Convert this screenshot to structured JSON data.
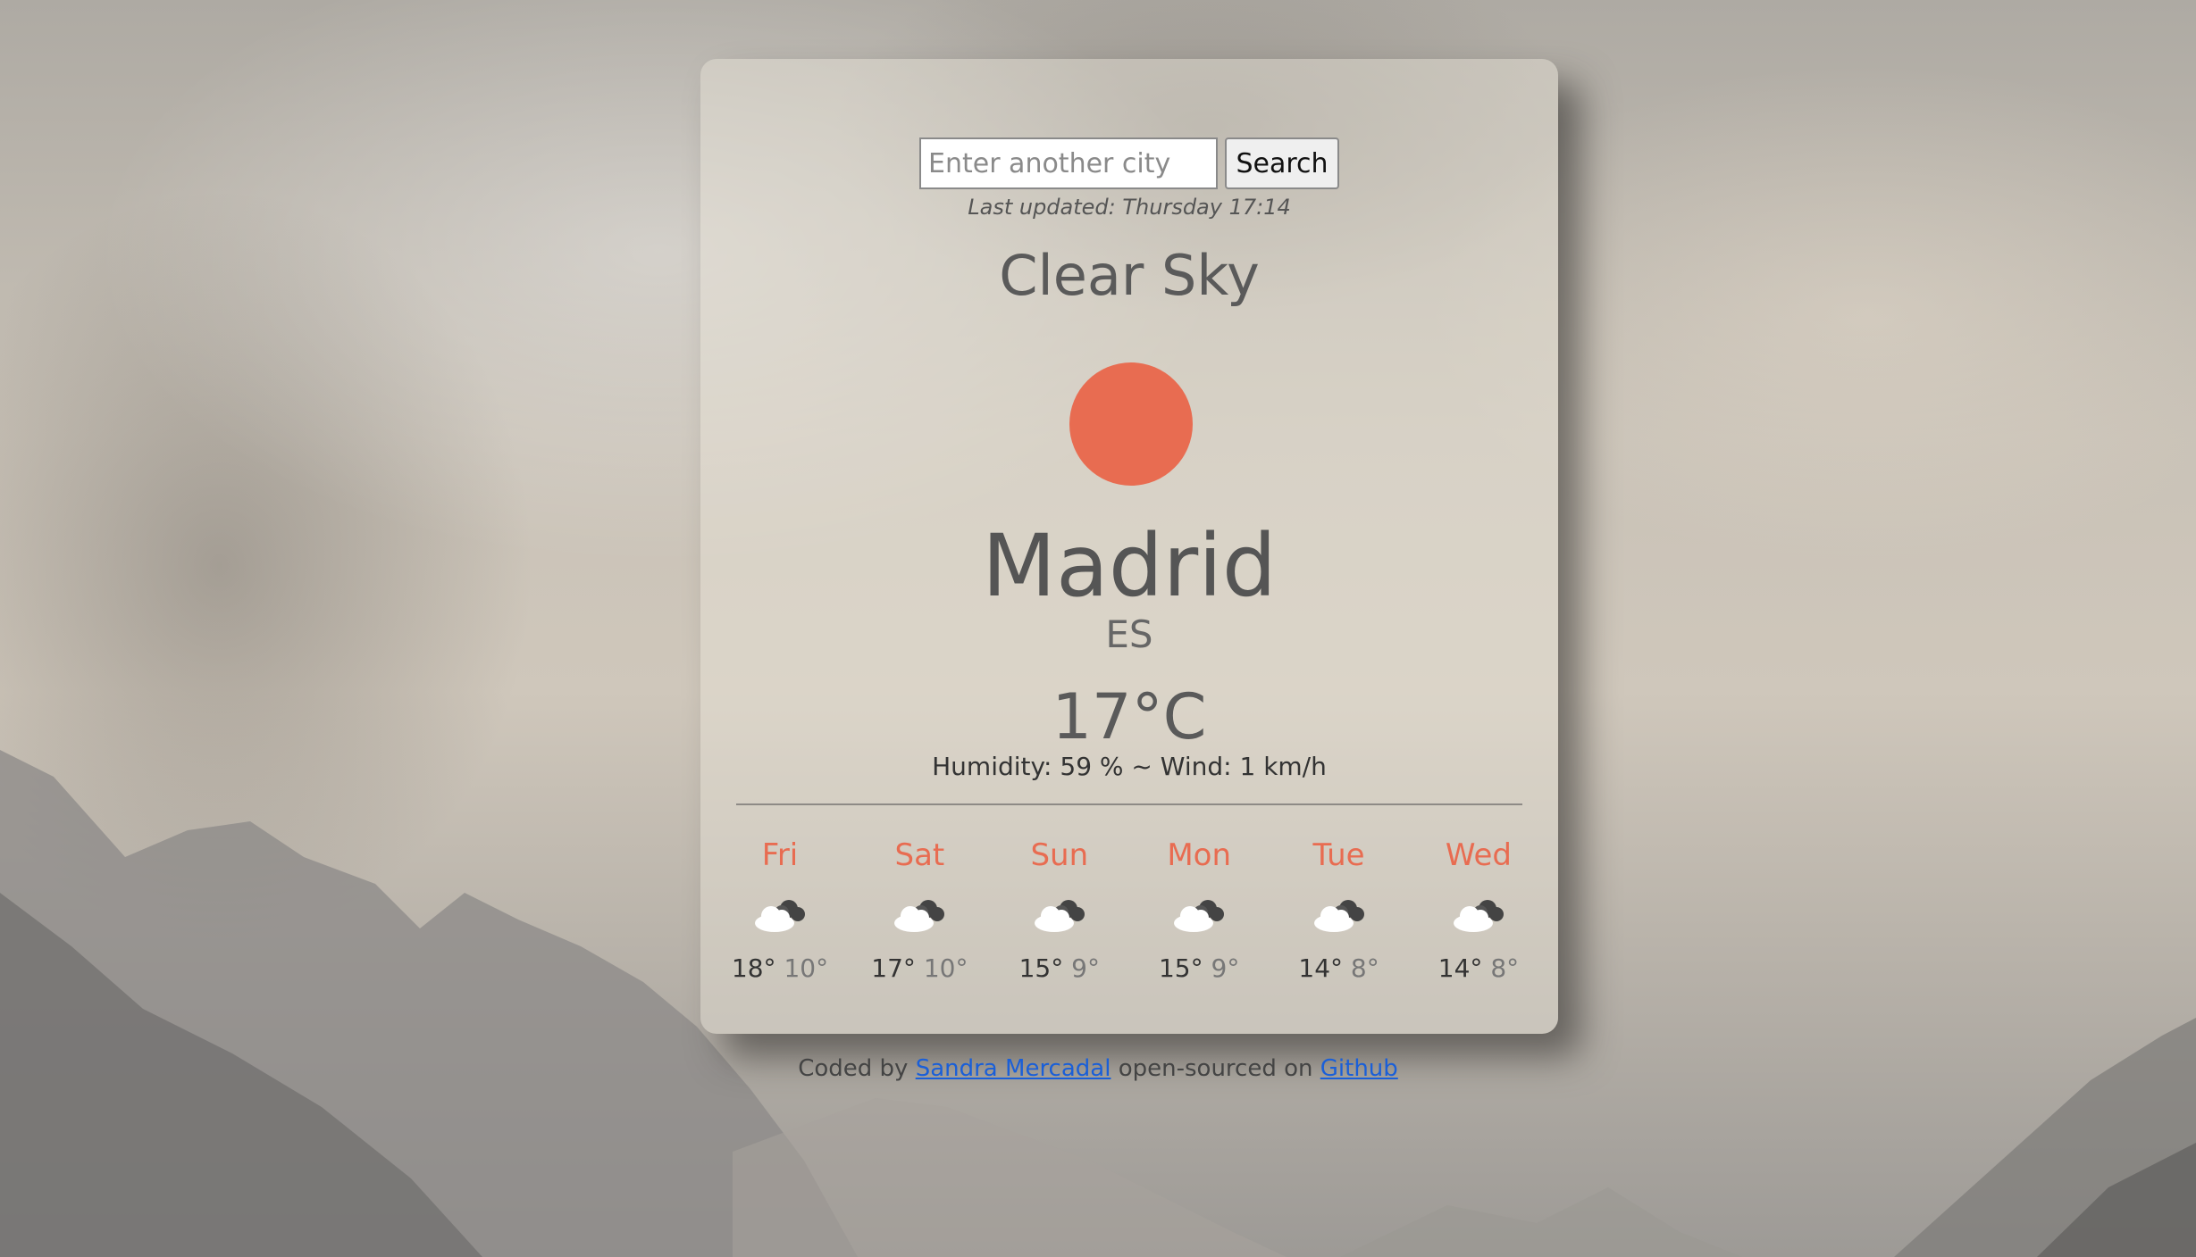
{
  "search": {
    "placeholder": "Enter another city",
    "button_label": "Search"
  },
  "last_updated": "Last updated: Thursday 17:14",
  "current": {
    "condition": "Clear Sky",
    "icon": "sun-icon",
    "city": "Madrid",
    "country": "ES",
    "temperature": "17°C",
    "details": "Humidity: 59 % ~ Wind: 1 km/h"
  },
  "forecast": [
    {
      "day": "Fri",
      "icon": "cloud-icon",
      "max": "18°",
      "min": "10°"
    },
    {
      "day": "Sat",
      "icon": "cloud-icon",
      "max": "17°",
      "min": "10°"
    },
    {
      "day": "Sun",
      "icon": "cloud-icon",
      "max": "15°",
      "min": "9°"
    },
    {
      "day": "Mon",
      "icon": "cloud-icon",
      "max": "15°",
      "min": "9°"
    },
    {
      "day": "Tue",
      "icon": "cloud-icon",
      "max": "14°",
      "min": "8°"
    },
    {
      "day": "Wed",
      "icon": "cloud-icon",
      "max": "14°",
      "min": "8°"
    }
  ],
  "footer": {
    "prefix": "Coded by",
    "author_link": "Sandra Mercadal",
    "middle": "open-sourced on",
    "repo_link": "Github"
  },
  "colors": {
    "accent": "#e86c51",
    "link": "#1a5fd8"
  }
}
